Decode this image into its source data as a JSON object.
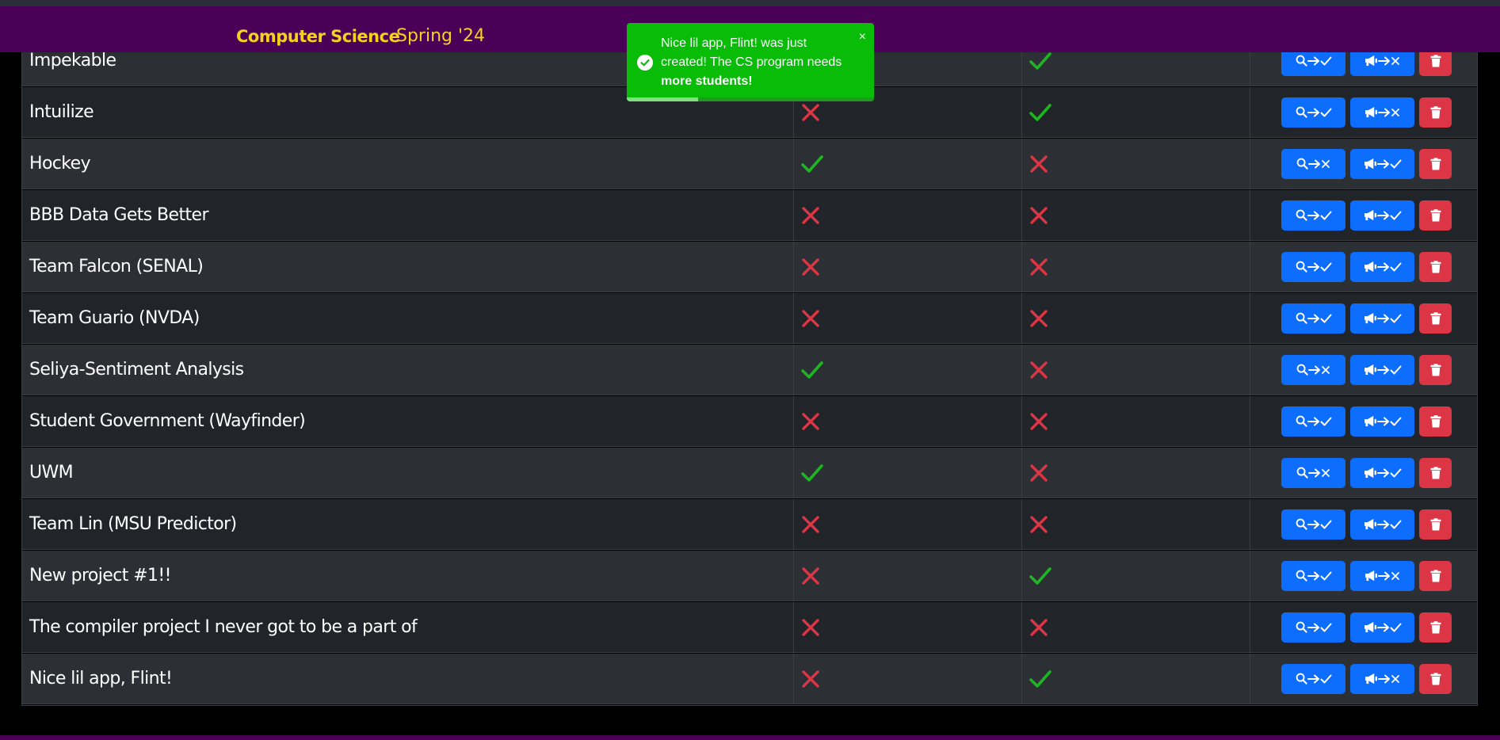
{
  "header": {
    "brand": "Computer Science",
    "term": "Spring '24"
  },
  "toast": {
    "message_part1": "Nice lil app, Flint! was just created! The CS program needs ",
    "message_bold": "more students!",
    "close": "×",
    "icon": "check-circle-icon",
    "progress_fraction": 0.29
  },
  "projects": [
    {
      "name": "Impekable",
      "col_a": true,
      "col_b": true,
      "discover": true,
      "announce": false
    },
    {
      "name": "Intuilize",
      "col_a": false,
      "col_b": true,
      "discover": true,
      "announce": false
    },
    {
      "name": "Hockey",
      "col_a": true,
      "col_b": false,
      "discover": false,
      "announce": true
    },
    {
      "name": "BBB Data Gets Better",
      "col_a": false,
      "col_b": false,
      "discover": true,
      "announce": true
    },
    {
      "name": "Team Falcon (SENAL)",
      "col_a": false,
      "col_b": false,
      "discover": true,
      "announce": true
    },
    {
      "name": "Team Guario (NVDA)",
      "col_a": false,
      "col_b": false,
      "discover": true,
      "announce": true
    },
    {
      "name": "Seliya-Sentiment Analysis",
      "col_a": true,
      "col_b": false,
      "discover": false,
      "announce": true
    },
    {
      "name": "Student Government (Wayfinder)",
      "col_a": false,
      "col_b": false,
      "discover": true,
      "announce": true
    },
    {
      "name": "UWM",
      "col_a": true,
      "col_b": false,
      "discover": false,
      "announce": true
    },
    {
      "name": "Team Lin (MSU Predictor)",
      "col_a": false,
      "col_b": false,
      "discover": true,
      "announce": true
    },
    {
      "name": "New project #1!!",
      "col_a": false,
      "col_b": true,
      "discover": true,
      "announce": false
    },
    {
      "name": "The compiler project I never got to be a part of",
      "col_a": false,
      "col_b": false,
      "discover": true,
      "announce": true
    },
    {
      "name": "Nice lil app, Flint!",
      "col_a": false,
      "col_b": true,
      "discover": true,
      "announce": false
    }
  ],
  "colors": {
    "header_bg": "#4a0057",
    "brand": "#f5d21e",
    "check": "#1db521",
    "cross": "#dc3545",
    "primary": "#0d6efd",
    "danger": "#dc3545",
    "toast": "#08bc08"
  }
}
